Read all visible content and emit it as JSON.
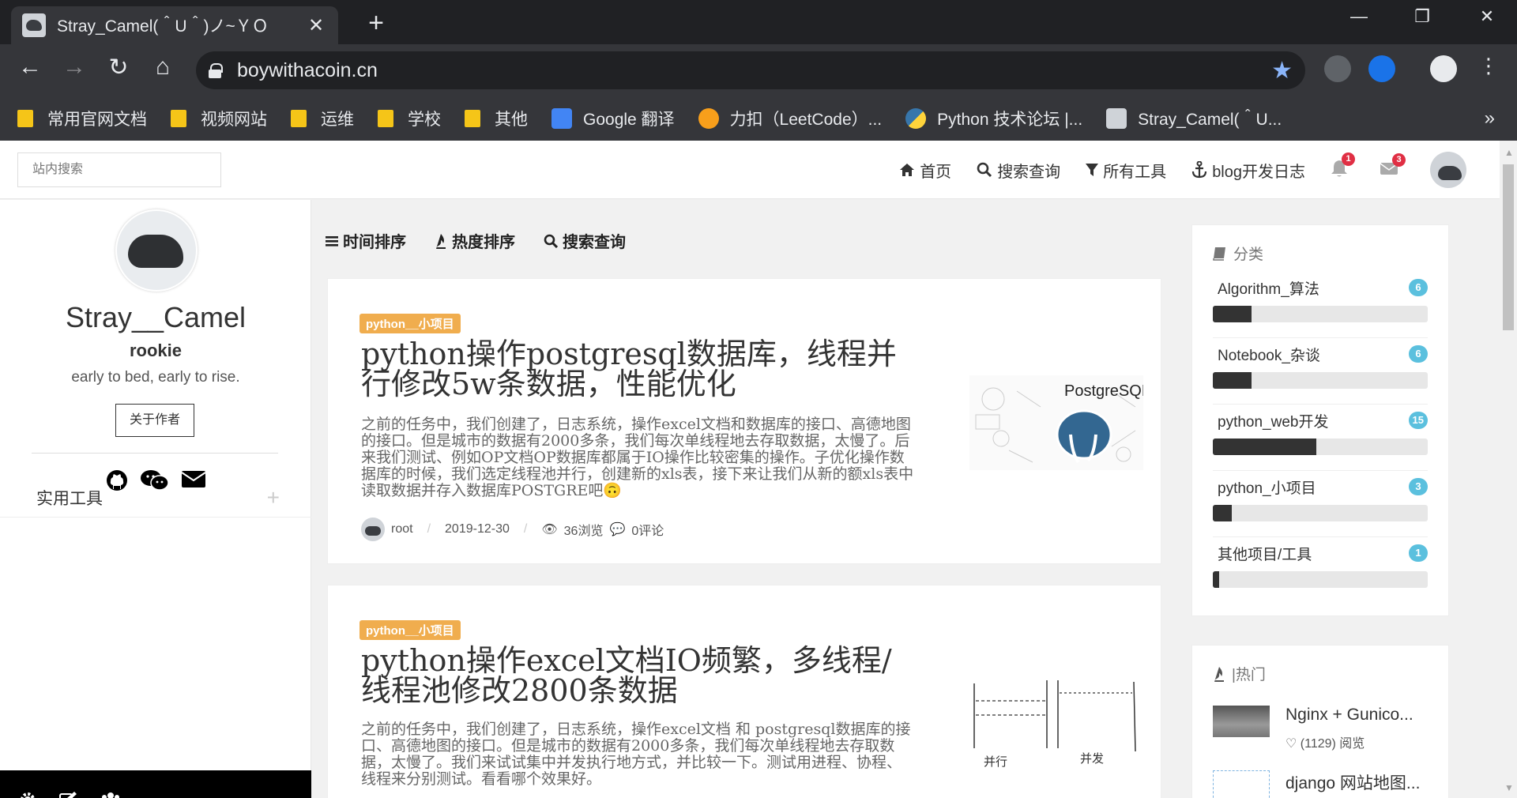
{
  "browser": {
    "tab_title": "Stray_Camel(＾U＾)ノ~ＹＯ",
    "tab_close": "✕",
    "new_tab": "+",
    "url": "boywithacoin.cn",
    "bookmarks": [
      {
        "label": "常用官网文档",
        "type": "folder"
      },
      {
        "label": "视频网站",
        "type": "folder"
      },
      {
        "label": "运维",
        "type": "folder"
      },
      {
        "label": "学校",
        "type": "folder"
      },
      {
        "label": "其他",
        "type": "folder"
      },
      {
        "label": "Google 翻译",
        "type": "google-translate"
      },
      {
        "label": "力扣（LeetCode）...",
        "type": "leetcode"
      },
      {
        "label": "Python 技术论坛 |...",
        "type": "python"
      },
      {
        "label": "Stray_Camel(＾U...",
        "type": "site"
      }
    ],
    "bookmark_more": "»"
  },
  "site": {
    "search_placeholder": "站内搜索",
    "menu": {
      "home": "首页",
      "search": "搜索查询",
      "tools": "所有工具",
      "devlog": "blog开发日志"
    },
    "notifications": "1",
    "messages": "3"
  },
  "sidebar": {
    "name": "Stray__Camel",
    "role": "rookie",
    "motto": "early to bed, early to rise.",
    "about_button": "关于作者",
    "tools_label": "实用工具",
    "tools_expand": "+"
  },
  "sorts": {
    "time": "时间排序",
    "hot": "热度排序",
    "search": "搜索查询"
  },
  "posts": [
    {
      "tag": "python__小项目",
      "title": "python操作postgresql数据库，线程并行修改5w条数据，性能优化",
      "excerpt": "之前的任务中，我们创建了，日志系统，操作excel文档和数据库的接口、高德地图的接口。但是城市的数据有2000多条，我们每次单线程地去存取数据，太慢了。后来我们测试、例如OP文档OP数据库都属于IO操作比较密集的操作。子优化操作数据库的时候，我们选定线程池并行，创建新的xls表，接下来让我们从新的额xls表中读取数据并存入数据库POSTGRE吧🙃",
      "author": "root",
      "date": "2019-12-30",
      "views": "36浏览",
      "comments": "0评论",
      "thumb_label": "PostgreSQL"
    },
    {
      "tag": "python__小项目",
      "title": "python操作excel文档IO频繁，多线程/线程池修改2800条数据",
      "excerpt": "之前的任务中，我们创建了，日志系统，操作excel文档 和 postgresql数据库的接口、高德地图的接口。但是城市的数据有2000多条，我们每次单线程地去存取数据，太慢了。我们来试试集中并发执行地方式，并比较一下。测试用进程、协程、线程来分别测试。看看哪个效果好。",
      "thumb_label_left": "并行",
      "thumb_label_right": "并发"
    }
  ],
  "categories": {
    "title": "分类",
    "items": [
      {
        "name": "Algorithm_算法",
        "count": "6",
        "share": 0.18
      },
      {
        "name": "Notebook_杂谈",
        "count": "6",
        "share": 0.18
      },
      {
        "name": "python_web开发",
        "count": "15",
        "share": 0.48
      },
      {
        "name": "python_小项目",
        "count": "3",
        "share": 0.09
      },
      {
        "name": "其他项目/工具",
        "count": "1",
        "share": 0.03
      }
    ]
  },
  "hot": {
    "title": "|热门",
    "items": [
      {
        "title": "Nginx + Gunico...",
        "meta": "(1129) 阅览"
      },
      {
        "title": "django 网站地图...",
        "meta": ""
      }
    ]
  },
  "colors": {
    "tag": "#f0ad4e",
    "badge_red": "#e02f44",
    "cat_badge": "#5bc0de",
    "bar_fill": "#333333"
  }
}
